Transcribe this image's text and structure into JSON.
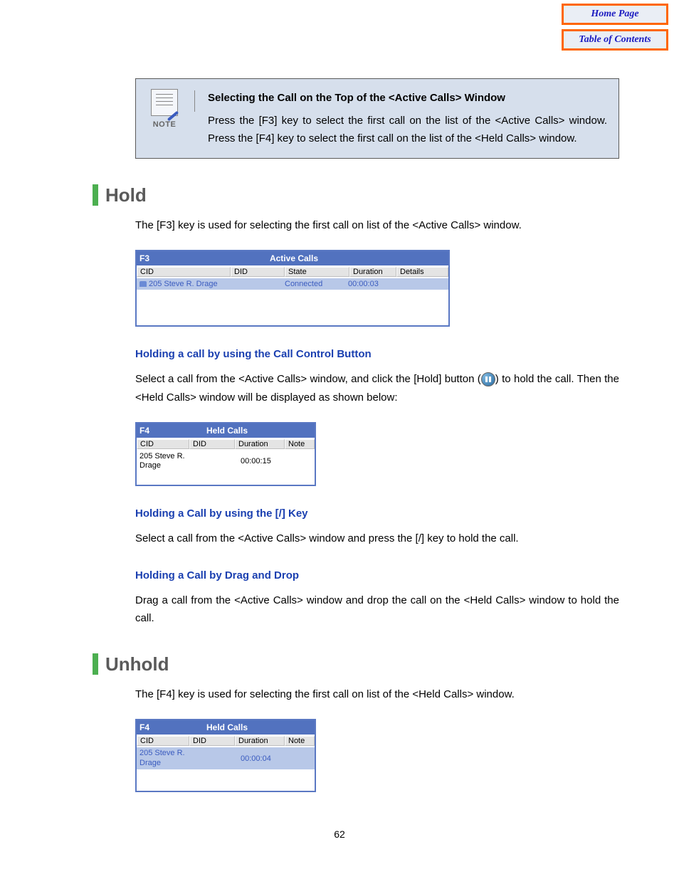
{
  "nav": {
    "home": "Home Page",
    "toc": "Table of Contents"
  },
  "note": {
    "label": "NOTE",
    "title": "Selecting the Call on the Top of the <Active Calls> Window",
    "body": "Press the [F3] key to select the first call on the list of the <Active Calls> window. Press the [F4] key to select the first call on the list of the <Held Calls> window."
  },
  "hold": {
    "title": "Hold",
    "intro": "The [F3] key is used for selecting the first call on list of the <Active Calls> window.",
    "activeCalls": {
      "key": "F3",
      "title": "Active Calls",
      "columns": {
        "cid": "CID",
        "did": "DID",
        "state": "State",
        "duration": "Duration",
        "details": "Details"
      },
      "row": {
        "cid": "205 Steve R. Drage",
        "did": "",
        "state": "Connected",
        "duration": "00:00:03",
        "details": ""
      }
    },
    "sub1": {
      "heading": "Holding a call by using the Call Control Button",
      "text_a": "Select a call from the <Active Calls> window, and click the [Hold] button (",
      "text_b": ") to hold the call. Then the <Held Calls> window will be displayed as shown below:"
    },
    "heldCalls1": {
      "key": "F4",
      "title": "Held Calls",
      "columns": {
        "cid": "CID",
        "did": "DID",
        "duration": "Duration",
        "note": "Note"
      },
      "row": {
        "cid": "205 Steve R. Drage",
        "did": "",
        "duration": "00:00:15",
        "note": ""
      }
    },
    "sub2": {
      "heading": "Holding a Call by using the [/] Key",
      "text": "Select a call from the <Active Calls> window and press the [/] key to hold the call."
    },
    "sub3": {
      "heading": "Holding a Call by Drag and Drop",
      "text": "Drag a call from the <Active Calls> window and drop the call on the <Held Calls> window to hold the call."
    }
  },
  "unhold": {
    "title": "Unhold",
    "intro": "The [F4] key is used for selecting the first call on list of the <Held Calls> window.",
    "heldCalls": {
      "key": "F4",
      "title": "Held Calls",
      "columns": {
        "cid": "CID",
        "did": "DID",
        "duration": "Duration",
        "note": "Note"
      },
      "row": {
        "cid": "205 Steve R. Drage",
        "did": "",
        "duration": "00:00:04",
        "note": ""
      }
    }
  },
  "page_number": "62"
}
